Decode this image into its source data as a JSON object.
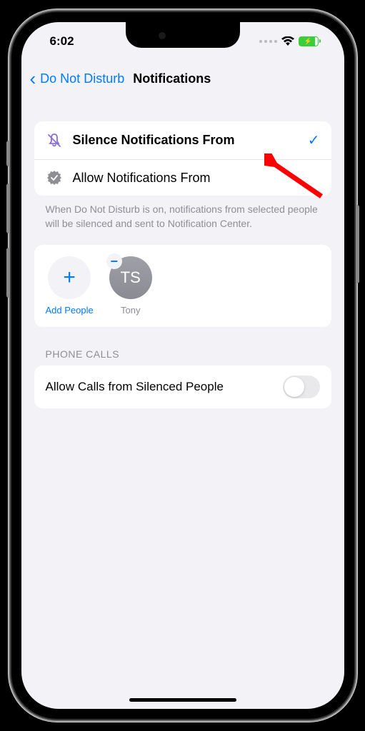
{
  "status": {
    "time": "6:02"
  },
  "nav": {
    "back_label": "Do Not Disturb",
    "title": "Notifications"
  },
  "options": {
    "silence": {
      "label": "Silence Notifications From",
      "selected": true
    },
    "allow": {
      "label": "Allow Notifications From",
      "selected": false
    }
  },
  "footer": "When Do Not Disturb is on, notifications from selected people will be silenced and sent to Notification Center.",
  "people": {
    "add_label": "Add People",
    "items": [
      {
        "initials": "TS",
        "name": "Tony"
      }
    ]
  },
  "phone_section": {
    "header": "PHONE CALLS",
    "allow_calls_label": "Allow Calls from Silenced People"
  }
}
